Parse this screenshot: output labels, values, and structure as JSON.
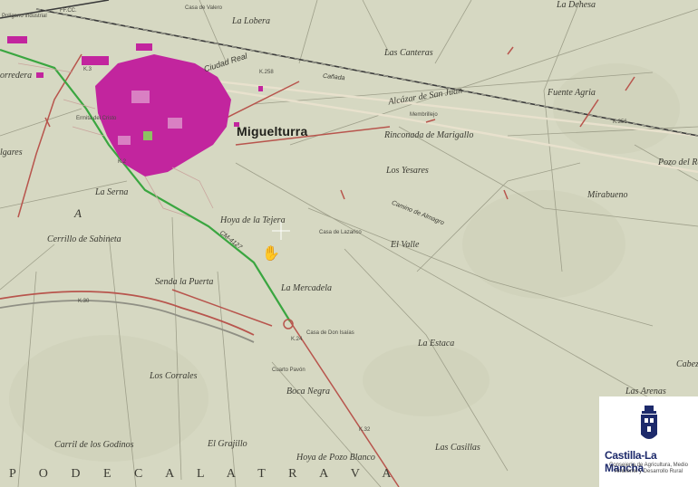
{
  "map": {
    "town": "Miguelturra",
    "region": "P O  D E   C A L A T R A V A",
    "places": [
      {
        "id": "poligono",
        "text": "Polígono Industrial"
      },
      {
        "id": "la-lobera",
        "text": "La Lobera"
      },
      {
        "id": "las-canteras",
        "text": "Las Canteras"
      },
      {
        "id": "la-dehesa",
        "text": "La Dehesa"
      },
      {
        "id": "alcazar",
        "text": "Alcázar  de  San Juan"
      },
      {
        "id": "fuente-agria",
        "text": "Fuente Agria"
      },
      {
        "id": "rinconada",
        "text": "Rinconada de Marigallo"
      },
      {
        "id": "pozo-del-re",
        "text": "Pozo del Re"
      },
      {
        "id": "los-yesares",
        "text": "Los Yesares"
      },
      {
        "id": "mirabueno",
        "text": "Mirabueno"
      },
      {
        "id": "la-serna",
        "text": "La Serna"
      },
      {
        "id": "hoya-tejera",
        "text": "Hoya de la Tejera"
      },
      {
        "id": "cerrillo",
        "text": "Cerrillo de Sabineta"
      },
      {
        "id": "el-valle",
        "text": "El Valle"
      },
      {
        "id": "senda",
        "text": "Senda la Puerta"
      },
      {
        "id": "la-mercadela",
        "text": "La Mercadela"
      },
      {
        "id": "la-estaca",
        "text": "La Estaca"
      },
      {
        "id": "los-corrales",
        "text": "Los Corrales"
      },
      {
        "id": "boca-negra",
        "text": "Boca Negra"
      },
      {
        "id": "carril",
        "text": "Carril de los Godinos"
      },
      {
        "id": "el-grajillo",
        "text": "El Grajillo"
      },
      {
        "id": "hoya-pozo",
        "text": "Hoya de Pozo Blanco"
      },
      {
        "id": "las-casillas",
        "text": "Las Casillas"
      },
      {
        "id": "las-arenas",
        "text": "Las Arenas"
      },
      {
        "id": "cabez",
        "text": "Cabez"
      },
      {
        "id": "orredera",
        "text": "orredera"
      },
      {
        "id": "lgares",
        "text": "lgares"
      },
      {
        "id": "letter-a",
        "text": "A"
      }
    ],
    "small_labels": [
      {
        "id": "casa-valero",
        "text": "Casa de Valero"
      },
      {
        "id": "casa-lazarico",
        "text": "Casa de Lazarico"
      },
      {
        "id": "casa-don-isaias",
        "text": "Casa de Don Isaías"
      },
      {
        "id": "cuarto-pavon",
        "text": "Cuarto Pavón"
      },
      {
        "id": "ermita",
        "text": "Ermita del Cristo"
      },
      {
        "id": "ffcc",
        "text": "FF.CC."
      },
      {
        "id": "k258",
        "text": "K.258"
      },
      {
        "id": "k256",
        "text": "K.256"
      },
      {
        "id": "k3",
        "text": "K.3"
      },
      {
        "id": "k2",
        "text": "K.2"
      },
      {
        "id": "k24",
        "text": "K.24"
      },
      {
        "id": "k30",
        "text": "K.30"
      },
      {
        "id": "k32",
        "text": "K.32"
      },
      {
        "id": "membrillejo",
        "text": "Membrillejo"
      }
    ],
    "roads": [
      {
        "id": "ciudad-real",
        "text": "Ciudad Real"
      },
      {
        "id": "cm4127",
        "text": "CM-4127"
      },
      {
        "id": "camino-alm",
        "text": "Camino de Almagro"
      },
      {
        "id": "canada",
        "text": "Cañada"
      }
    ]
  },
  "logo": {
    "name": "Castilla-La Mancha",
    "sub": "Consejería de Agricultura, Medio Ambiente y Desarrollo Rural"
  },
  "colors": {
    "paper": "#d6d8c2",
    "urban": "#c2259e",
    "road_green": "#3aa640",
    "road_red": "#b8554d",
    "rail": "#3a3a3a"
  }
}
